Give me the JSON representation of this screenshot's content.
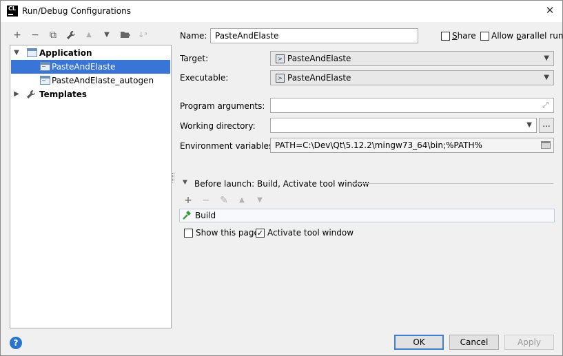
{
  "window": {
    "app_icon_text": "CL",
    "title": "Run/Debug Configurations",
    "close_glyph": "✕"
  },
  "tree_toolbar": [
    {
      "icon": "add-icon",
      "glyph": "+",
      "enabled": true
    },
    {
      "icon": "remove-icon",
      "glyph": "−",
      "enabled": true
    },
    {
      "icon": "copy-icon",
      "glyph": "⧉",
      "enabled": true
    },
    {
      "icon": "wrench-icon",
      "glyph": "🔧",
      "enabled": true
    },
    {
      "icon": "move-up-icon",
      "glyph": "▲",
      "enabled": false
    },
    {
      "icon": "move-down-icon",
      "glyph": "▼",
      "enabled": true
    },
    {
      "icon": "new-folder-icon",
      "glyph": "📁",
      "enabled": true
    },
    {
      "icon": "sort-icon",
      "glyph": "↓ᵃ",
      "enabled": false
    }
  ],
  "tree": {
    "application": {
      "label": "Application",
      "expanded": true
    },
    "configs": [
      {
        "label": "PasteAndElaste",
        "selected": true
      },
      {
        "label": "PasteAndElaste_autogen",
        "selected": false
      }
    ],
    "templates": {
      "label": "Templates",
      "expanded": false
    }
  },
  "form": {
    "name_label": "Name:",
    "name_value": "PasteAndElaste",
    "share_label": "Share",
    "share_checked": false,
    "parallel_label": "Allow parallel run",
    "parallel_checked": false,
    "target_label": "Target:",
    "target_value": "PasteAndElaste",
    "executable_label": "Executable:",
    "executable_value": "PasteAndElaste",
    "program_args_label": "Program arguments:",
    "program_args_value": "",
    "working_dir_label": "Working directory:",
    "working_dir_value": "",
    "browse_label": "...",
    "env_label": "Environment variables:",
    "env_value": "PATH=C:\\Dev\\Qt\\5.12.2\\mingw73_64\\bin;%PATH%"
  },
  "before_launch": {
    "title": "Before launch: Build, Activate tool window",
    "toolbar": [
      {
        "icon": "add-icon",
        "glyph": "+",
        "enabled": true
      },
      {
        "icon": "remove-icon",
        "glyph": "−",
        "enabled": false
      },
      {
        "icon": "edit-icon",
        "glyph": "✎",
        "enabled": false
      },
      {
        "icon": "move-up-icon",
        "glyph": "▲",
        "enabled": false
      },
      {
        "icon": "move-down-icon",
        "glyph": "▼",
        "enabled": false
      }
    ],
    "tasks": [
      {
        "label": "Build",
        "icon": "hammer-icon"
      }
    ],
    "show_page_label": "Show this page",
    "show_page_checked": false,
    "activate_label": "Activate tool window",
    "activate_checked": true
  },
  "footer": {
    "help_glyph": "?",
    "ok_label": "OK",
    "cancel_label": "Cancel",
    "apply_label": "Apply",
    "apply_enabled": false
  }
}
